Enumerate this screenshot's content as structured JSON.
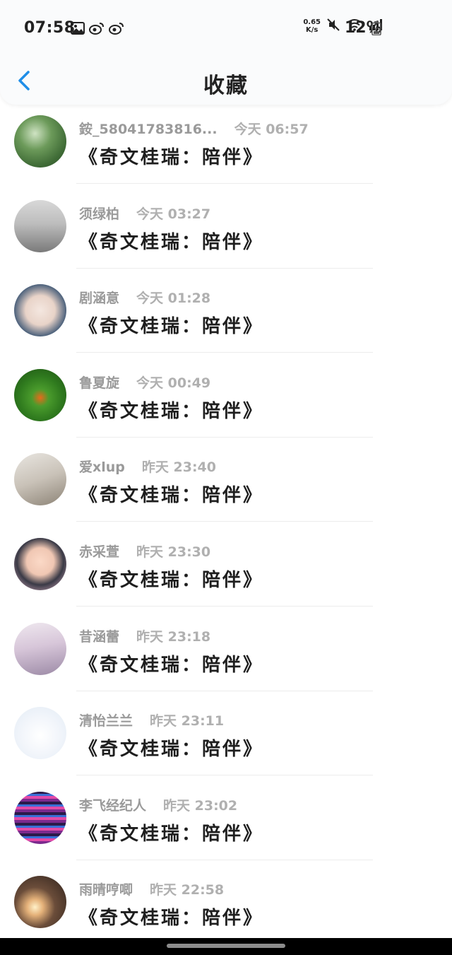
{
  "status_bar": {
    "time": "07:58",
    "net_speed_value": "0.65",
    "net_speed_unit": "K/s",
    "battery": "12%",
    "left_icons": [
      "image-icon",
      "weibo-icon",
      "weibo-icon"
    ],
    "right_icons": [
      "mute-icon",
      "wifi-icon",
      "signal-icon",
      "battery-icon"
    ]
  },
  "nav": {
    "title": "收藏",
    "back_icon": "chevron-left-icon"
  },
  "colors": {
    "accent": "#1f8ee8",
    "name_text": "#9a9a9a",
    "time_text": "#b0b0b0",
    "content_text": "#1e1e1e",
    "header_bg": "#fafbfc"
  },
  "items": [
    {
      "name": "銨_58041783816...",
      "time": "今天 06:57",
      "content": "《奇文桂瑞：陪伴》"
    },
    {
      "name": "须绿柏",
      "time": "今天 03:27",
      "content": "《奇文桂瑞：陪伴》"
    },
    {
      "name": "剧涵意",
      "time": "今天 01:28",
      "content": "《奇文桂瑞：陪伴》"
    },
    {
      "name": "鲁夏旋",
      "time": "今天 00:49",
      "content": "《奇文桂瑞：陪伴》"
    },
    {
      "name": "爱xlup",
      "time": "昨天 23:40",
      "content": "《奇文桂瑞：陪伴》"
    },
    {
      "name": "赤采萱",
      "time": "昨天 23:30",
      "content": "《奇文桂瑞：陪伴》"
    },
    {
      "name": "昔涵蕾",
      "time": "昨天 23:18",
      "content": "《奇文桂瑞：陪伴》"
    },
    {
      "name": "清怡兰兰",
      "time": "昨天 23:11",
      "content": "《奇文桂瑞：陪伴》"
    },
    {
      "name": "李飞经纪人",
      "time": "昨天 23:02",
      "content": "《奇文桂瑞：陪伴》"
    },
    {
      "name": "雨晴哼唧",
      "time": "昨天 22:58",
      "content": "《奇文桂瑞：陪伴》"
    }
  ]
}
